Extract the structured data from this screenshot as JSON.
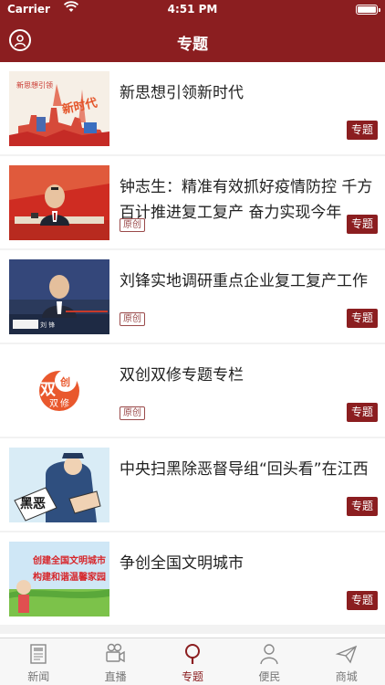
{
  "status_bar": {
    "carrier": "Carrier",
    "time": "4:51 PM"
  },
  "header": {
    "title": "专题"
  },
  "articles": [
    {
      "title": "新思想引领新时代",
      "tag": "专题",
      "original": ""
    },
    {
      "title": "钟志生：精准有效抓好疫情防控 千方百计推进复工复产 奋力实现今年",
      "tag": "专题",
      "original": "原创"
    },
    {
      "title": "刘锋实地调研重点企业复工复产工作",
      "tag": "专题",
      "original": "原创"
    },
    {
      "title": "双创双修专题专栏",
      "tag": "专题",
      "original": "原创"
    },
    {
      "title": "中央扫黑除恶督导组“回头看”在江西",
      "tag": "专题",
      "original": ""
    },
    {
      "title": "争创全国文明城市",
      "tag": "专题",
      "original": ""
    }
  ],
  "thumbs": {
    "t1": "新时代",
    "t2": "新思想引领",
    "t4_a": "双",
    "t4_b": "创",
    "t4_c": "双",
    "t4_d": "修",
    "t5": "黑恶",
    "t6_a": "创建全国文明城市",
    "t6_b": "构建和谐温馨家园",
    "t3_badge": "刘 锋"
  },
  "tabs": [
    {
      "label": "新闻",
      "icon": "newspaper-icon"
    },
    {
      "label": "直播",
      "icon": "video-camera-icon"
    },
    {
      "label": "专题",
      "icon": "magnifier-icon"
    },
    {
      "label": "便民",
      "icon": "person-icon"
    },
    {
      "label": "商城",
      "icon": "paper-plane-icon"
    }
  ],
  "colors": {
    "brand": "#8b1e20",
    "tab_inactive": "#777777"
  },
  "active_tab": "专题"
}
